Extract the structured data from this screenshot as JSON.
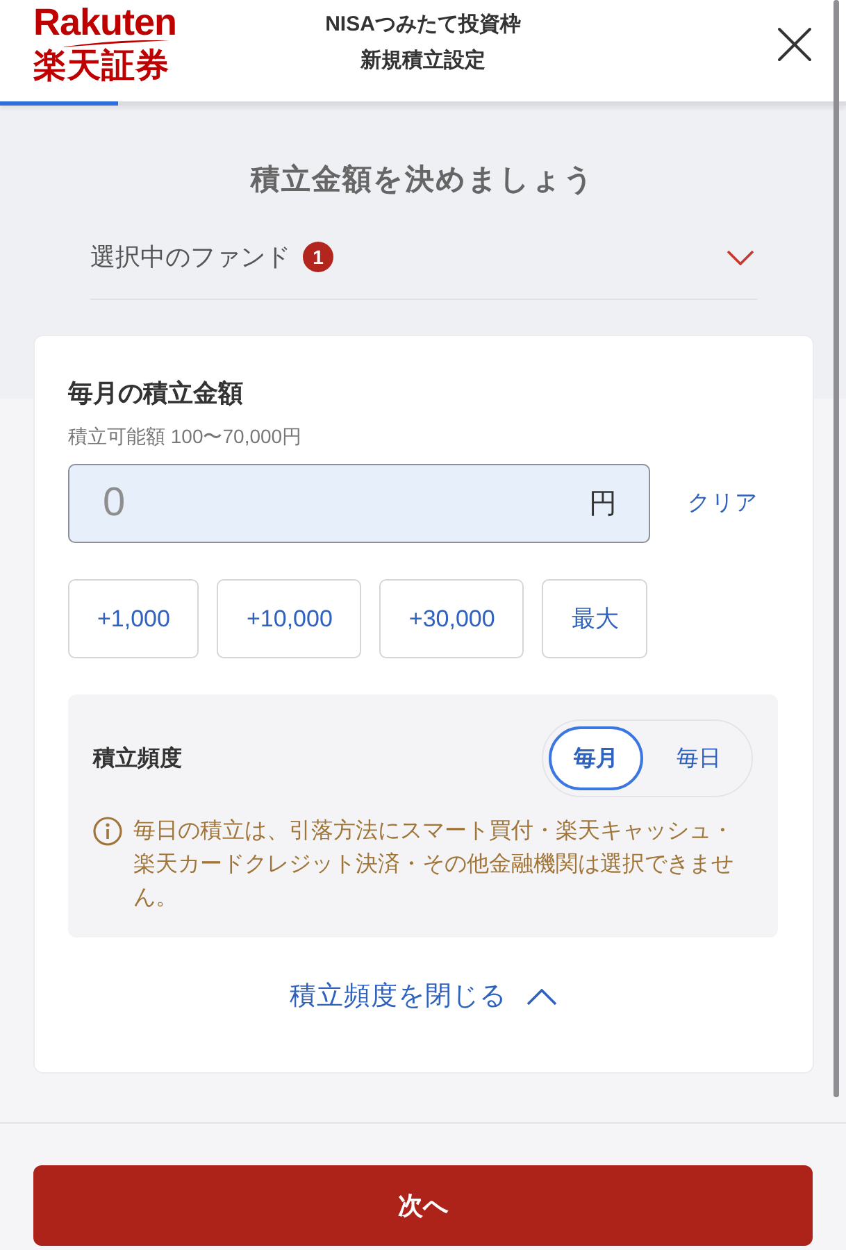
{
  "header": {
    "logo": {
      "wordmark": "Rakuten",
      "subtitle": "楽天証券"
    },
    "title": "NISAつみたて投資枠",
    "subtitle": "新規積立設定"
  },
  "progress": {
    "level": 0.14
  },
  "heading": "積立金額を決めましょう",
  "fund_selector": {
    "label": "選択中のファンド",
    "count": "1",
    "expanded": false
  },
  "amount_card": {
    "title": "毎月の積立金額",
    "range_note": "積立可能額 100〜70,000円",
    "amount_field": {
      "placeholder": "0",
      "unit": "円"
    },
    "clear_link": "クリア",
    "quick_buttons": [
      "+1,000",
      "+10,000",
      "+30,000",
      "最大"
    ],
    "frequency": {
      "expanded": true,
      "label": "積立頻度",
      "options": [
        {
          "label": "毎月",
          "selected": true
        },
        {
          "label": "毎日",
          "selected": false
        }
      ],
      "notice": "毎日の積立は、引落方法にスマート買付・楽天キャッシュ・楽天カードクレジット決済・その他金融機関は選択できません。"
    },
    "collapse_link": "積立頻度を閉じる"
  },
  "next_button": "次へ"
}
